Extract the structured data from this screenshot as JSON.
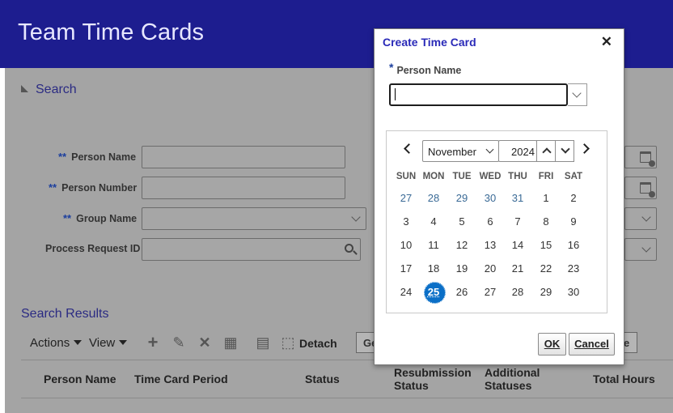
{
  "app": {
    "title": "Team Time Cards"
  },
  "search": {
    "toggle_label": "Search",
    "required_marker": "**",
    "fields": {
      "person_name": {
        "label": "Person Name",
        "value": ""
      },
      "person_number": {
        "label": "Person Number",
        "value": ""
      },
      "group_name": {
        "label": "Group Name",
        "value": ""
      },
      "process_request_id": {
        "label": "Process Request ID",
        "value": ""
      }
    }
  },
  "results": {
    "title": "Search Results",
    "toolbar": {
      "actions_label": "Actions",
      "view_label": "View",
      "add_icon": "plus-icon",
      "edit_icon": "pencil-icon",
      "delete_icon": "x-icon",
      "export_icon": "grid-icon",
      "filter_icon": "filter-icon",
      "detach_icon": "detach-icon",
      "detach_label": "Detach",
      "go_label": "Ge",
      "right_button_label": "e"
    },
    "columns": {
      "person_name": "Person Name",
      "time_card_period": "Time Card Period",
      "status": "Status",
      "resubmission_status": "Resubmission Status",
      "additional_statuses": "Additional Statuses",
      "total_hours": "Total Hours"
    }
  },
  "dialog": {
    "title": "Create Time Card",
    "close_icon": "close-icon",
    "required_marker": "*",
    "person_name_label": "Person Name",
    "person_name_value": "",
    "calendar": {
      "month": "November",
      "year": "2024",
      "weekdays": [
        "SUN",
        "MON",
        "TUE",
        "WED",
        "THU",
        "FRI",
        "SAT"
      ],
      "weeks": [
        [
          "27",
          "28",
          "29",
          "30",
          "31",
          "1",
          "2"
        ],
        [
          "3",
          "4",
          "5",
          "6",
          "7",
          "8",
          "9"
        ],
        [
          "10",
          "11",
          "12",
          "13",
          "14",
          "15",
          "16"
        ],
        [
          "17",
          "18",
          "19",
          "20",
          "21",
          "22",
          "23"
        ],
        [
          "24",
          "25",
          "26",
          "27",
          "28",
          "29",
          "30"
        ]
      ],
      "other_month_days": [
        "27",
        "28",
        "29",
        "30",
        "31"
      ],
      "selected_day": "25",
      "accent_color": "#0b6fc7"
    },
    "ok_label": "OK",
    "cancel_label": "Cancel"
  },
  "colors": {
    "header_bg": "#1d1d8f",
    "overlay_bg": "#a4a4a4",
    "link_blue": "#2b2b83"
  }
}
